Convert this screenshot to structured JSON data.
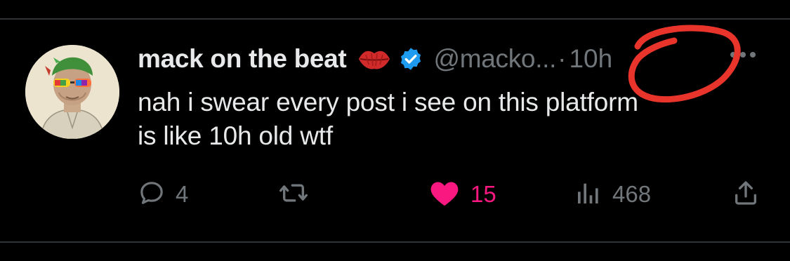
{
  "tweet": {
    "author": {
      "display_name": "mack on the beat",
      "handle": "@macko...",
      "verified": true,
      "name_emoji": "kiss-mark-lips"
    },
    "timestamp_separator": "·",
    "timestamp": "10h",
    "text_lines": [
      "nah i swear every post i see on this platform",
      "is like 10h old wtf"
    ],
    "actions": {
      "replies": "4",
      "retweets": "",
      "likes": "15",
      "views": "468",
      "liked": true
    }
  },
  "colors": {
    "background": "#000000",
    "primary_text": "#e7e9ea",
    "secondary_text": "#71767b",
    "verified_blue": "#1d9bf0",
    "like_pink": "#f91880",
    "annotation_red": "#e8342a",
    "divider": "#2f3336"
  },
  "icons": {
    "reply": "speech-bubble-icon",
    "retweet": "retweet-arrows-icon",
    "like": "heart-icon",
    "views": "bar-chart-icon",
    "share": "share-upload-icon",
    "more": "more-dots-icon"
  }
}
